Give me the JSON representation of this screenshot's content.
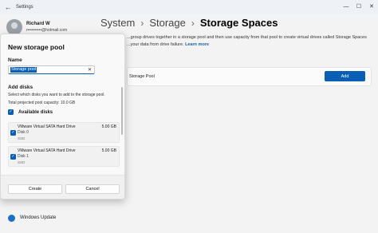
{
  "window": {
    "title": "Settings",
    "controls": {
      "minimize": "—",
      "maximize": "☐",
      "close": "✕"
    },
    "back_glyph": "←"
  },
  "user": {
    "name": "Richard W",
    "email": "r••••••••••@hotmail.com"
  },
  "sidebar": {
    "items": [
      {
        "label": "Windows Update",
        "icon": "windows-update-icon"
      }
    ]
  },
  "breadcrumb": {
    "items": [
      "System",
      "Storage",
      "Storage Spaces"
    ],
    "separator": "›"
  },
  "main": {
    "description": "...group drives together in a storage pool and then use capacity from that pool to create virtual drives called Storage Spaces ...your data from drive failure.",
    "learn_more": "Learn more",
    "pool_card_label": "Storage Pool",
    "add_button": "Add"
  },
  "dialog": {
    "title": "New storage pool",
    "name_label": "Name",
    "name_value": "Storage pool",
    "clear_glyph": "✕",
    "add_disks_title": "Add disks",
    "add_disks_desc": "Select which disks you want to add to the storage pool.",
    "capacity": "Total projected pool capacity: 10.0 GB",
    "available_label": "Available disks",
    "check_glyph": "✓",
    "disks": [
      {
        "name": "VMware Virtual SATA Hard Drive",
        "size": "5.00 GB",
        "disk": "Disk 0",
        "type": "SSD",
        "checked": true
      },
      {
        "name": "VMware Virtual SATA Hard Drive",
        "size": "5.00 GB",
        "disk": "Disk 1",
        "type": "SSD",
        "checked": true
      }
    ],
    "create_button": "Create",
    "cancel_button": "Cancel"
  },
  "colors": {
    "accent": "#0a5fb5",
    "background": "#f3f3f3",
    "dialog": "#f9f9f9"
  }
}
